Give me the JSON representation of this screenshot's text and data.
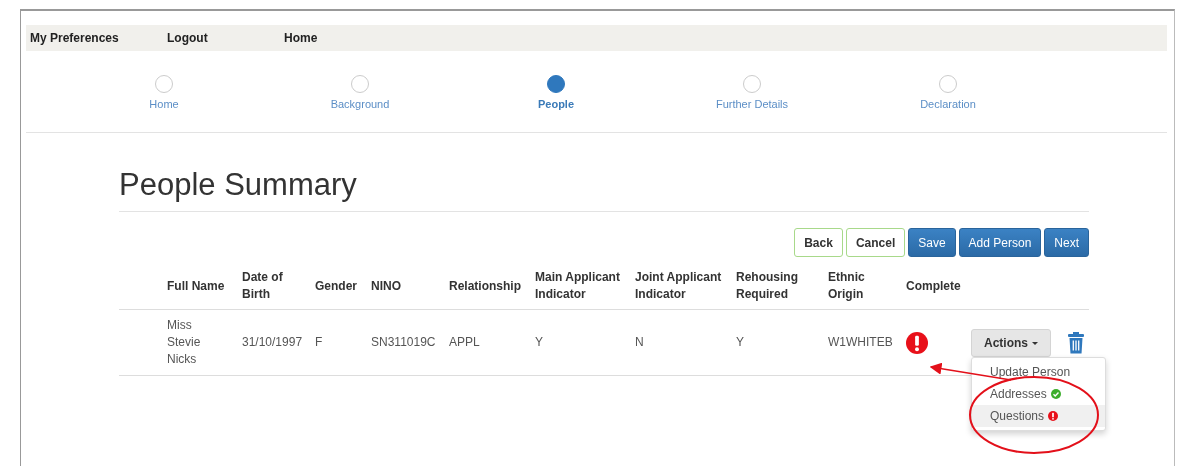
{
  "nav": [
    {
      "label": "My Preferences"
    },
    {
      "label": "Logout"
    },
    {
      "label": "Home"
    }
  ],
  "steps": [
    {
      "label": "Home",
      "selected": false
    },
    {
      "label": "Background",
      "selected": false
    },
    {
      "label": "People",
      "selected": true
    },
    {
      "label": "Further Details",
      "selected": false
    },
    {
      "label": "Declaration",
      "selected": false
    }
  ],
  "title": "People Summary",
  "buttons": [
    {
      "label": "Back",
      "kind": "outline"
    },
    {
      "label": "Cancel",
      "kind": "outline"
    },
    {
      "label": "Save",
      "kind": "primary"
    },
    {
      "label": "Add Person",
      "kind": "primary"
    },
    {
      "label": "Next",
      "kind": "primary"
    }
  ],
  "table": {
    "columns": [
      "Full Name",
      "Date of Birth",
      "Gender",
      "NINO",
      "Relationship",
      "Main Applicant Indicator",
      "Joint Applicant Indicator",
      "Rehousing Required",
      "Ethnic Origin",
      "Complete"
    ],
    "rows": [
      {
        "cells": [
          "Miss Stevie Nicks",
          "31/10/1997",
          "F",
          "SN311019C",
          "APPL",
          "Y",
          "N",
          "Y",
          "W1WHITEB"
        ],
        "complete": false,
        "actions": "Actions",
        "menu": [
          {
            "label": "Update Person",
            "selected": false
          },
          {
            "label": "Addresses",
            "complete": true,
            "selected": false
          },
          {
            "label": "Questions",
            "complete": false,
            "selected": true
          }
        ]
      }
    ]
  }
}
